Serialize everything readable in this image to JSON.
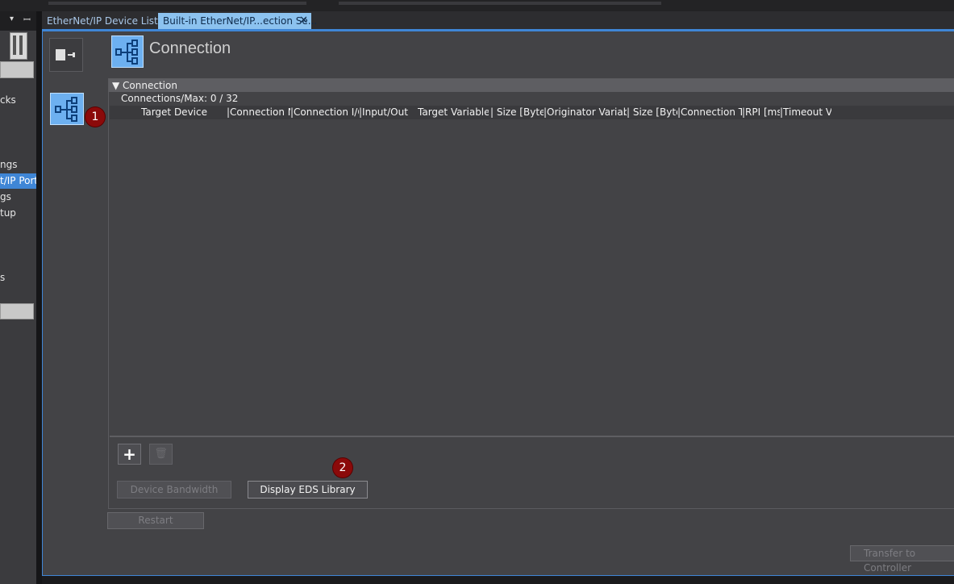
{
  "left_pane": {
    "items": [
      {
        "label": "cks",
        "active": false
      },
      {
        "label": "ngs",
        "active": false
      },
      {
        "label": "t/IP Port",
        "active": true
      },
      {
        "label": "gs",
        "active": false
      },
      {
        "label": "tup",
        "active": false
      },
      {
        "label": "s",
        "active": false
      }
    ]
  },
  "tabs": [
    {
      "label": "EtherNet/IP Device List",
      "active": false
    },
    {
      "label": "Built-in EtherNet/IP...ection Se...",
      "active": true,
      "close": "✕"
    }
  ],
  "header": {
    "title": "Connection",
    "icon": "connection-diagram-icon"
  },
  "section": {
    "header_label": "Connection",
    "connections_label": "Connections/Max: 0 / 32"
  },
  "table": {
    "columns": [
      "Target Device",
      "Connection Na",
      "Connection I/O",
      "Input/Out",
      "Target Variable",
      "Size [Byte]",
      "Originator Variable",
      "Size [Byte]",
      "Connection Ty",
      "RPI [ms]",
      "Timeout V"
    ],
    "rows": []
  },
  "badges": {
    "one": "1",
    "two": "2"
  },
  "buttons": {
    "add": "+",
    "delete": "🗑",
    "device_bandwidth": "Device Bandwidth",
    "display_eds_library": "Display EDS Library",
    "restart": "Restart",
    "transfer": "Transfer to Controller"
  },
  "colors": {
    "accent": "#3f86d6",
    "selection": "#6db0f0",
    "badge": "#8b0a0a"
  }
}
